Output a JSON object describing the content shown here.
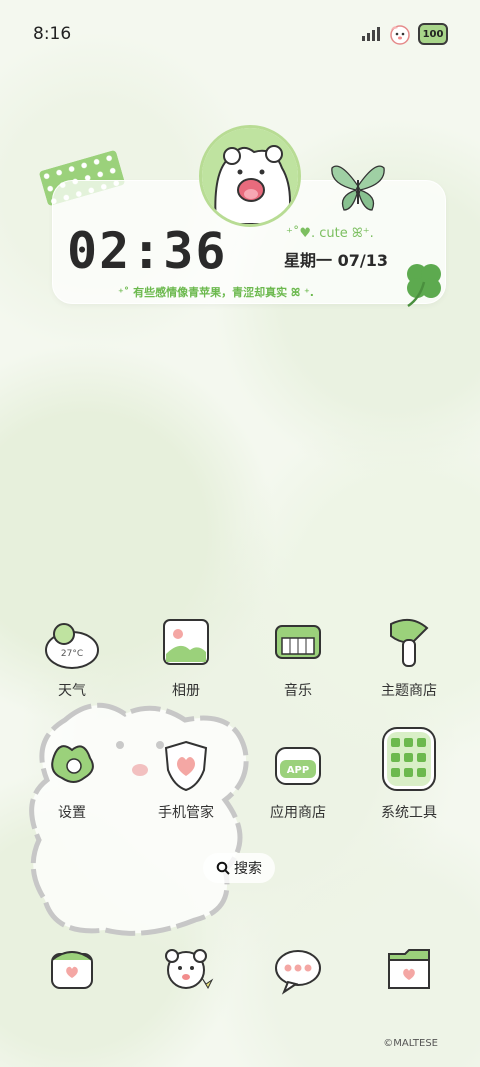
{
  "status_bar": {
    "time": "8:16",
    "battery": "100"
  },
  "widget": {
    "clock": "02:36",
    "tag": "cute",
    "weekday": "星期一",
    "date": "07/13",
    "quote": "有些感情像青苹果，青涩却真实"
  },
  "apps_row1": [
    {
      "label": "天气",
      "icon": "weather-icon",
      "sub": "27°C"
    },
    {
      "label": "相册",
      "icon": "gallery-icon"
    },
    {
      "label": "音乐",
      "icon": "music-icon"
    },
    {
      "label": "主题商店",
      "icon": "theme-store-icon"
    }
  ],
  "apps_row2": [
    {
      "label": "设置",
      "icon": "settings-icon"
    },
    {
      "label": "手机管家",
      "icon": "phone-manager-icon"
    },
    {
      "label": "应用商店",
      "icon": "app-store-icon",
      "badge": "APP"
    },
    {
      "label": "系统工具",
      "icon": "system-tools-folder-icon"
    }
  ],
  "search": {
    "label": "搜索"
  },
  "dock": [
    {
      "icon": "phone-icon"
    },
    {
      "icon": "camera-icon"
    },
    {
      "icon": "messages-icon"
    },
    {
      "icon": "files-icon"
    }
  ],
  "copyright": "©MALTESE",
  "colors": {
    "accent": "#9bd17b",
    "accent_dark": "#6cb94e",
    "pink": "#f4a7a4"
  }
}
